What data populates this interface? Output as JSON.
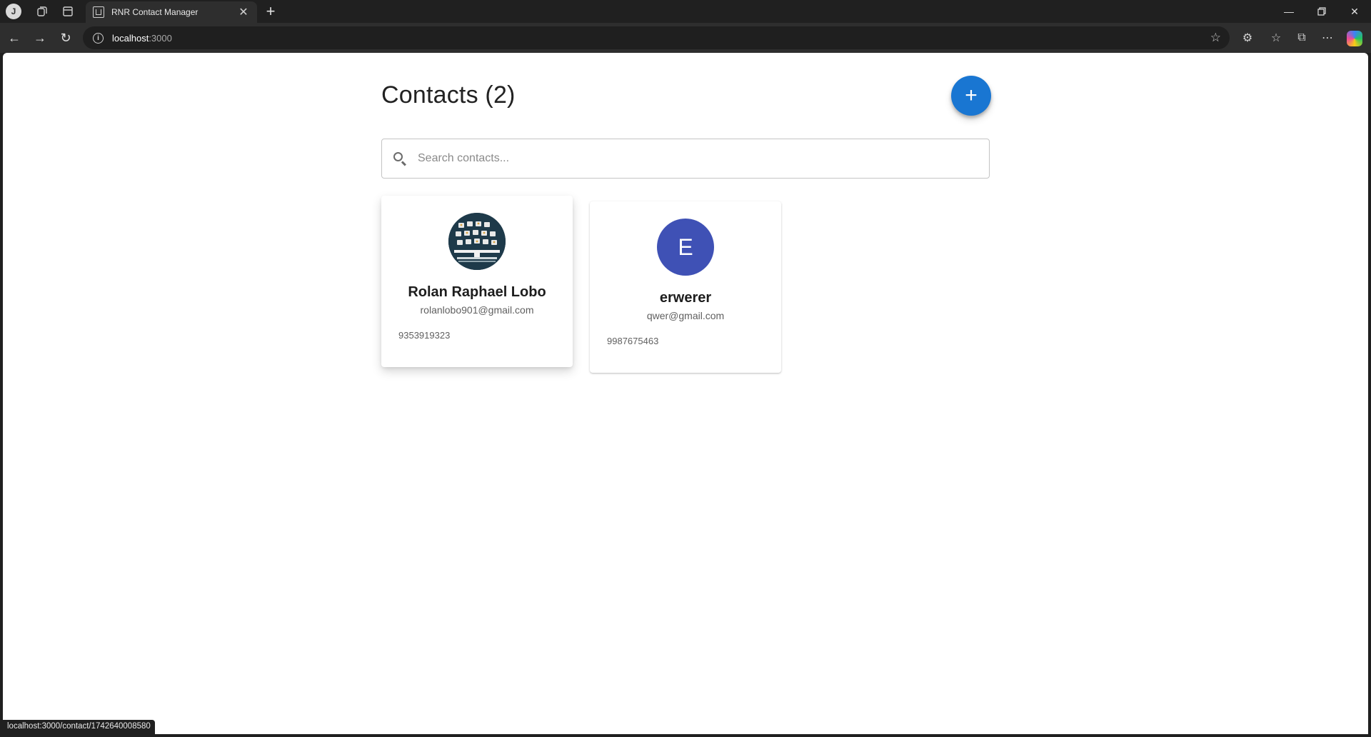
{
  "browser": {
    "tab_title": "RNR Contact Manager",
    "url_host": "localhost",
    "url_port": ":3000",
    "status_url": "localhost:3000/contact/1742640008580"
  },
  "page": {
    "title": "Contacts (2)",
    "add_button_label": "+",
    "search_placeholder": "Search contacts..."
  },
  "contacts": [
    {
      "name": "Rolan Raphael Lobo",
      "email": "rolanlobo901@gmail.com",
      "phone": "9353919323",
      "avatar": "image"
    },
    {
      "name": "erwerer",
      "email": "qwer@gmail.com",
      "phone": "9987675463",
      "avatar_initial": "E",
      "avatar_color": "#3f51b5"
    }
  ],
  "colors": {
    "primary": "#1976d2",
    "avatar_indigo": "#3f51b5"
  }
}
